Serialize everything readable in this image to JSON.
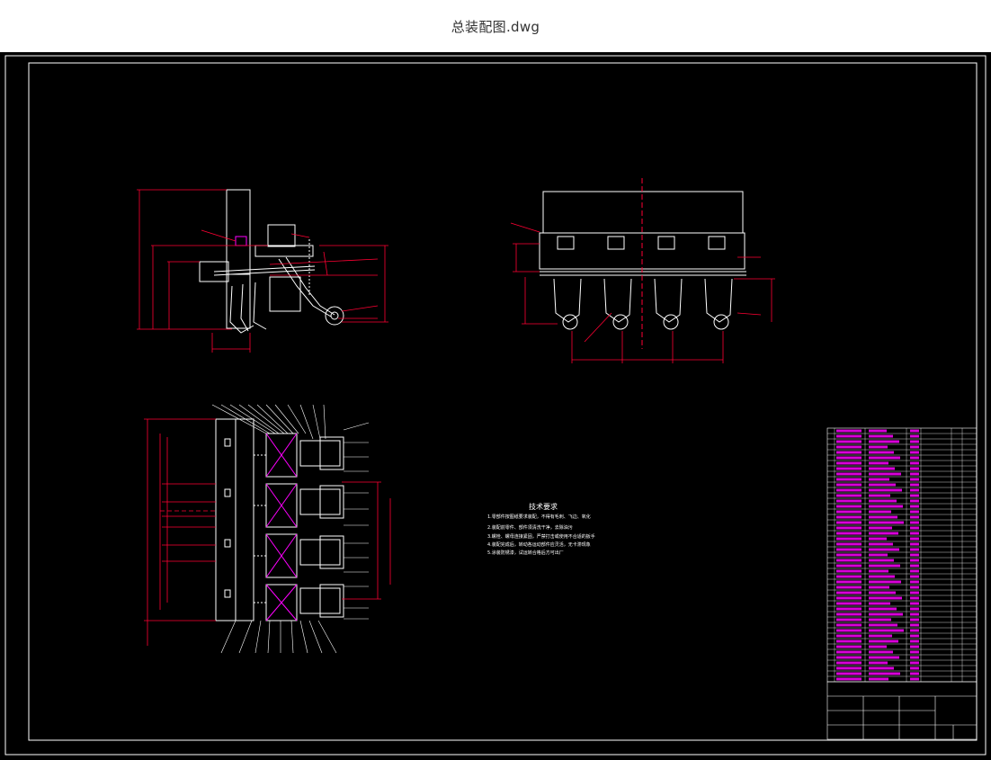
{
  "window": {
    "title": "总装配图.dwg"
  },
  "drawing": {
    "tech_requirements_title": "技术要求",
    "tech_requirements": [
      "1.零部件按图纸要求装配，不得有毛刺、飞边、氧化",
      "2.装配前零件、部件须清洗干净，去除油污",
      "3.螺栓、螺母连接紧固，严禁打击或使用不合适的扳手",
      "4.装配完成后，转动各运动部件应灵活，无卡滞现象",
      "5.涂装防锈漆，试运转合格后方可出厂"
    ]
  },
  "colors": {
    "background": "#000000",
    "frame": "#ffffff",
    "dimension": "#ff0033",
    "parts_table": "#ff00ff"
  }
}
